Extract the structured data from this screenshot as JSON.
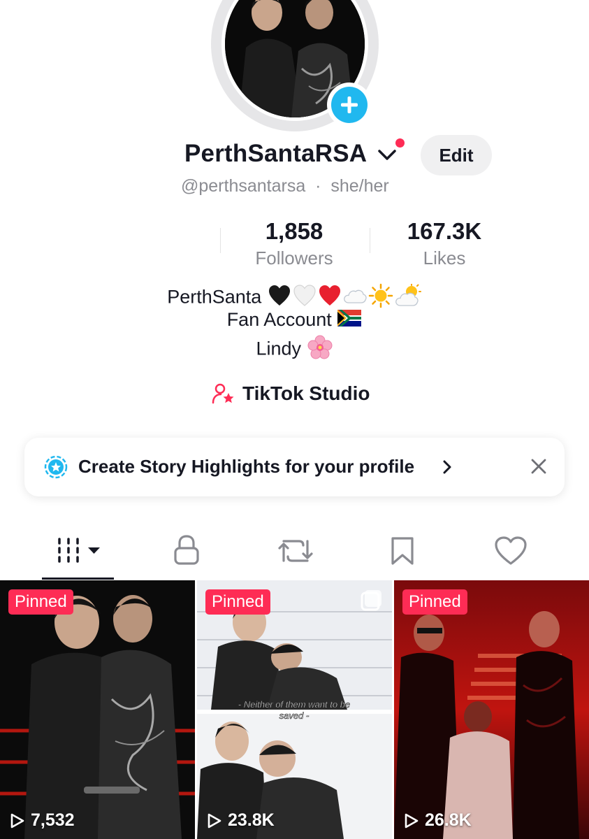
{
  "profile": {
    "display_name": "PerthSantaRSA",
    "handle": "@perthsantarsa",
    "pronouns": "she/her",
    "edit_label": "Edit"
  },
  "stats": {
    "followers": {
      "value": "1,858",
      "label": "Followers"
    },
    "likes": {
      "value": "167.3K",
      "label": "Likes"
    }
  },
  "bio": {
    "line1": "PerthSanta",
    "line2": "Fan Account",
    "line3": "Lindy"
  },
  "studio": {
    "label": "TikTok Studio"
  },
  "highlight_banner": {
    "text": "Create Story Highlights for your profile"
  },
  "tabs": [
    {
      "icon": "grid-icon"
    },
    {
      "icon": "lock-icon"
    },
    {
      "icon": "repost-icon"
    },
    {
      "icon": "bookmark-icon"
    },
    {
      "icon": "heart-icon"
    }
  ],
  "videos": [
    {
      "badge": "Pinned",
      "views": "7,532"
    },
    {
      "badge": "Pinned",
      "views": "23.8K",
      "caption": "- Neither of them want to be saved -"
    },
    {
      "badge": "Pinned",
      "views": "26.8K"
    }
  ],
  "colors": {
    "accent": "#fe2c55",
    "plus_blue": "#20b8ef",
    "text_primary": "#161823",
    "text_secondary": "#8a8b91"
  }
}
